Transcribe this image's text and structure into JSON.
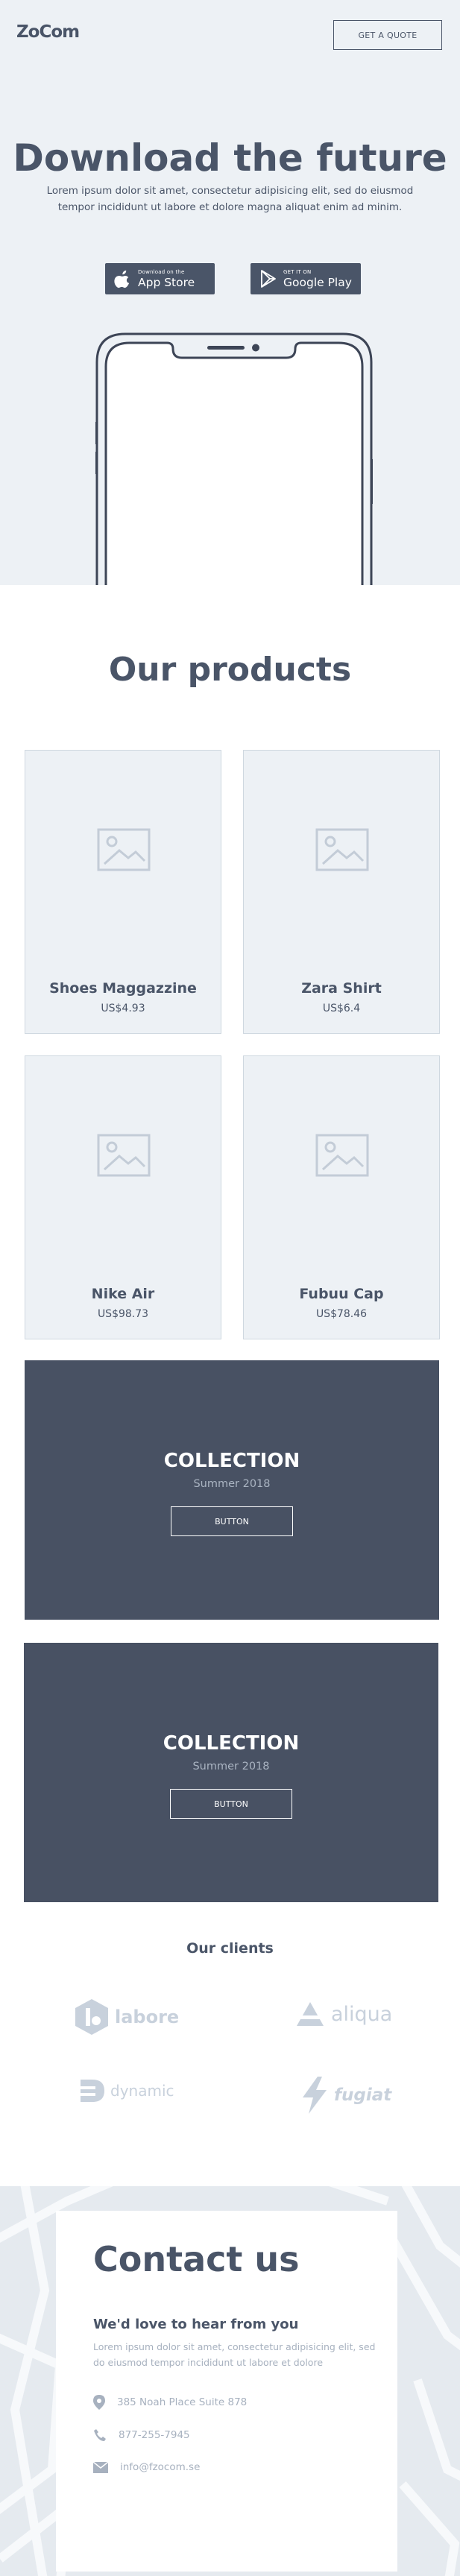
{
  "header": {
    "logo": "ZoCom",
    "quote_button": "GET A QUOTE"
  },
  "hero": {
    "title": "Download the future",
    "subtitle": "Lorem ipsum dolor sit amet, consectetur adipisicing elit, sed do eiusmod tempor incididunt ut labore et dolore magna aliquat enim ad minim.",
    "app_store": {
      "small": "Download on the",
      "big": "App Store"
    },
    "google_play": {
      "small": "GET IT ON",
      "big": "Google Play"
    }
  },
  "products": {
    "title": "Our products",
    "items": [
      {
        "name": "Shoes Maggazzine",
        "price": "US$4.93"
      },
      {
        "name": "Zara Shirt",
        "price": "US$6.4"
      },
      {
        "name": "Nike Air",
        "price": "US$98.73"
      },
      {
        "name": "Fubuu Cap",
        "price": "US$78.46"
      }
    ]
  },
  "collections": [
    {
      "title": "COLLECTION",
      "subtitle": "Summer 2018",
      "button": "BUTTON"
    },
    {
      "title": "COLLECTION",
      "subtitle": "Summer 2018",
      "button": "BUTTON"
    }
  ],
  "clients": {
    "title": "Our clients",
    "logos": [
      "labore",
      "aliqua",
      "dynamic",
      "fugiat"
    ]
  },
  "contact": {
    "title": "Contact us",
    "subtitle": "We'd love to hear from you",
    "description": "Lorem ipsum dolor sit amet, consectetur adipisicing elit, sed do eiusmod tempor incididunt ut labore et dolore",
    "address": "385 Noah Place Suite 878",
    "phone": "877-255-7945",
    "email": "info@fzocom.se"
  },
  "colors": {
    "primary": "#4a5568",
    "hero_bg": "#edf1f5",
    "collection_bg": "#485163",
    "muted": "#a7b1bf"
  }
}
